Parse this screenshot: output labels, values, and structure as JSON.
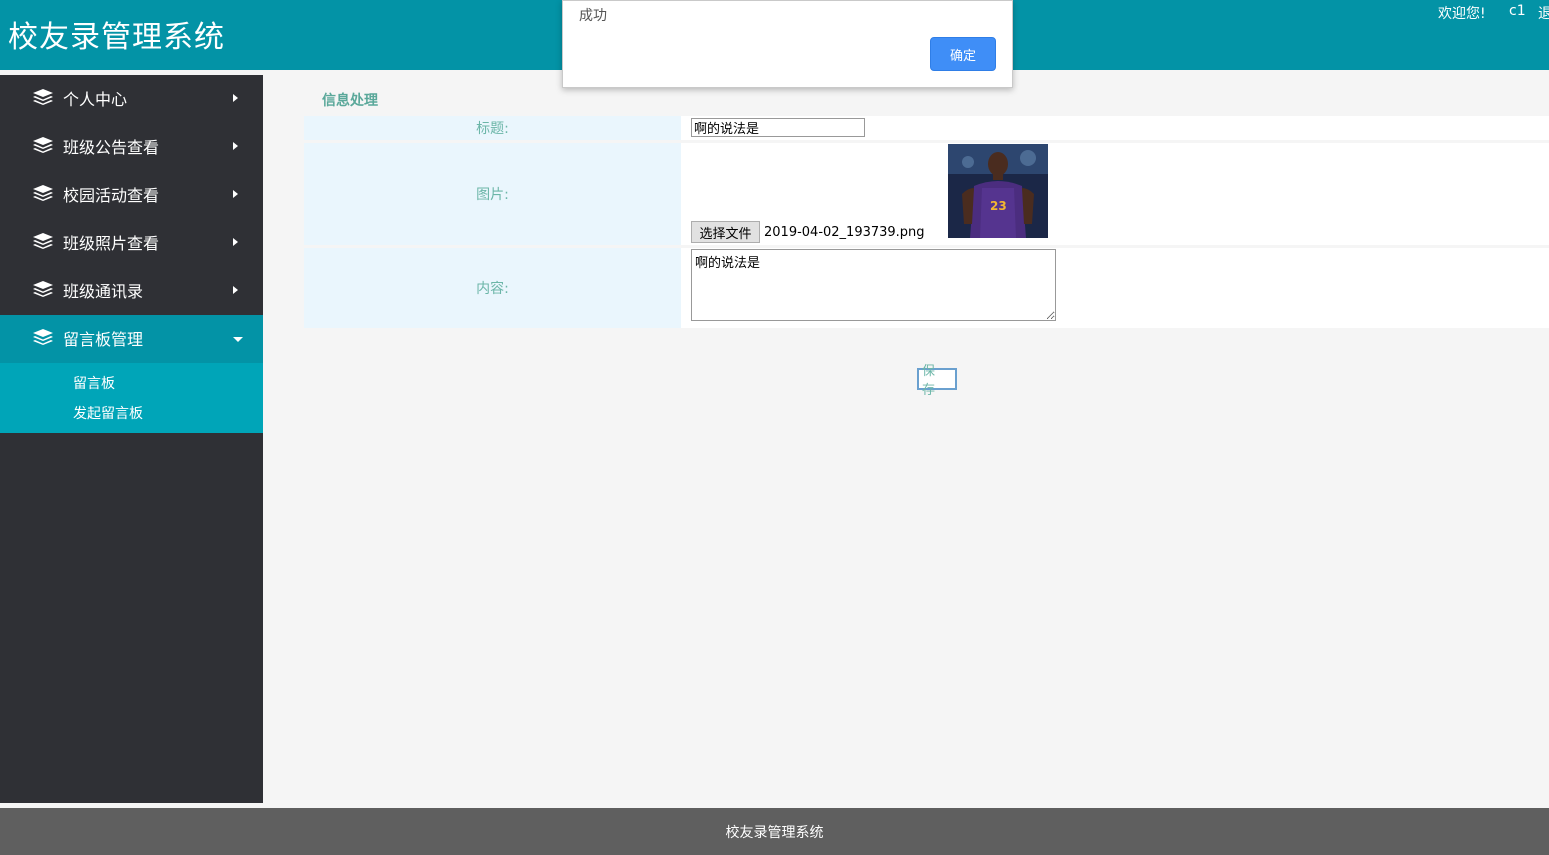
{
  "header": {
    "app_title": "校友录管理系统",
    "welcome": "欢迎您!",
    "username": "c1",
    "logout": "退"
  },
  "sidebar": {
    "items": [
      {
        "label": "个人中心",
        "icon": "layers-icon",
        "expanded": false
      },
      {
        "label": "班级公告查看",
        "icon": "layers-icon",
        "expanded": false
      },
      {
        "label": "校园活动查看",
        "icon": "layers-icon",
        "expanded": false
      },
      {
        "label": "班级照片查看",
        "icon": "layers-icon",
        "expanded": false
      },
      {
        "label": "班级通讯录",
        "icon": "layers-icon",
        "expanded": false
      },
      {
        "label": "留言板管理",
        "icon": "layers-icon",
        "expanded": true
      }
    ],
    "subitems": [
      "留言板",
      "发起留言板"
    ]
  },
  "main": {
    "section_title": "信息处理",
    "title_label": "标题:",
    "title_value": "啊的说法是",
    "image_label": "图片:",
    "file_button": "选择文件",
    "file_name": "2019-04-02_193739.png",
    "content_label": "内容:",
    "content_value": "啊的说法是",
    "save_button": "保存"
  },
  "footer": {
    "text": "校友录管理系统"
  },
  "dialog": {
    "message": "成功",
    "ok_button": "确定"
  },
  "colors": {
    "brand": "#0393a6",
    "sidebar_bg": "#2f3035",
    "submenu_bg": "#00a5b8",
    "dialog_button": "#3f8ef7"
  }
}
